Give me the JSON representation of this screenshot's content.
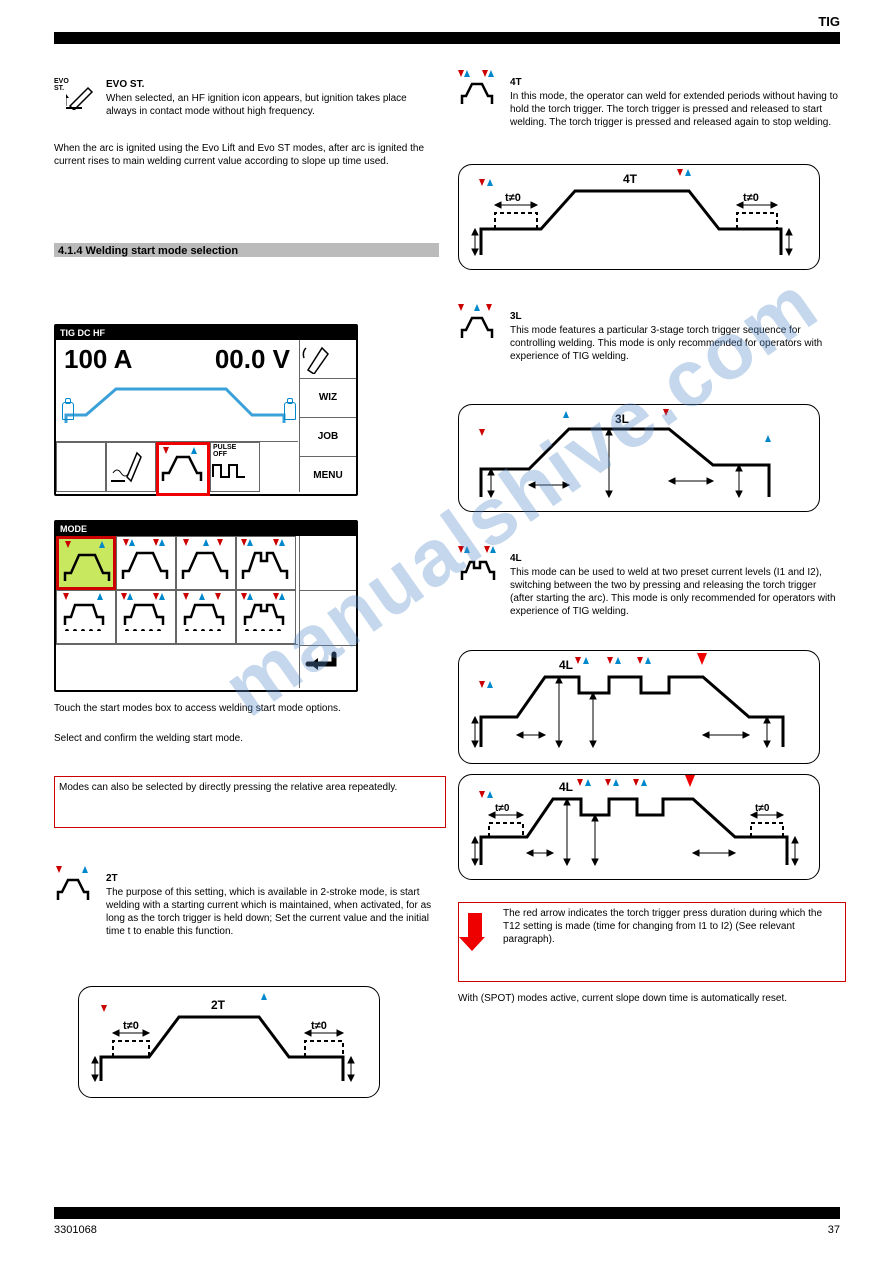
{
  "hdr": {
    "title": "TIG"
  },
  "footL": "3301068",
  "footR": "37",
  "sec_evo": {
    "name": "EVO ST.",
    "p1": "When selected, an HF ignition icon appears, but ignition takes place always in contact mode without high frequency.",
    "p2": "When the arc is ignited using the Evo Lift and Evo ST modes, after arc is ignited the current rises to main welding current value according to slope up time used."
  },
  "sec_mode": {
    "title": "4.1.4 Welding start mode selection"
  },
  "display": {
    "header": "TIG DC HF",
    "amps": "100 A",
    "volts": "00.0 V",
    "wiz": "WIZ",
    "job": "JOB",
    "menu": "MENU",
    "dc": "DC",
    "pulse": "PULSE\nOFF"
  },
  "modegrid": {
    "title": "MODE"
  },
  "touch": "Touch the start modes box to access welding start mode options.",
  "select": "Select and confirm the welding start mode.",
  "note1": "Modes can also be selected by directly pressing the relative area repeatedly.",
  "modes": {
    "t2": {
      "name": "2T",
      "desc": "The purpose of this setting, which is available in 2-stroke mode, is start welding with a starting current which is maintained, when activated, for as long as the torch trigger is held down; Set the current value and the initial time t to enable this function.",
      "label": "2T"
    },
    "t4": {
      "name": "4T",
      "desc": "In this mode, the operator can weld for extended periods without having to hold the torch trigger. The torch trigger is pressed and released to start welding. The torch trigger is pressed and released again to stop welding.",
      "label": "4T"
    },
    "t3l": {
      "name": "3L",
      "desc": "This mode features a particular 3-stage torch trigger sequence for controlling welding. This mode is only recommended for operators with experience of TIG welding.",
      "label": "3L"
    },
    "t4l": {
      "name": "4L",
      "desc": "This mode can be used to weld at two preset current levels (I1 and I2), switching between the two by pressing and releasing the torch trigger (after starting the arc). This mode is only recommended for operators with experience of TIG welding.",
      "label": "4L"
    },
    "red_arrow_note": "The red arrow indicates the torch trigger press duration during which the T12 setting is made (time for changing from I1 to I2) (See relevant paragraph).",
    "spot": "With (SPOT) modes active, current slope down time is automatically reset."
  },
  "tne": "t≠0"
}
